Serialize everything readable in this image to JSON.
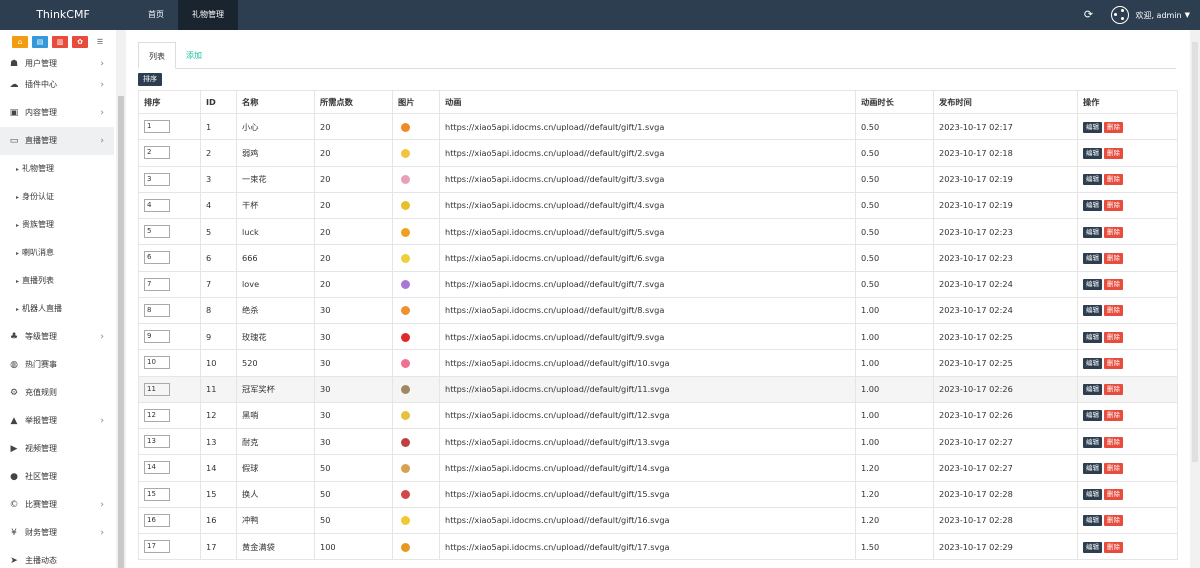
{
  "brand": "ThinkCMF",
  "topnav": [
    {
      "label": "首页",
      "active": false
    },
    {
      "label": "礼物管理",
      "active": true
    }
  ],
  "user": {
    "welcome": "欢迎, admin"
  },
  "sidebar": {
    "quick_colors": [
      "#f39c12",
      "#3498db",
      "#e74c3c",
      "#e74c3c"
    ],
    "items": [
      {
        "label": "用户管理",
        "icon": "users-icon",
        "arrow": true
      },
      {
        "label": "插件中心",
        "icon": "cloud-icon",
        "arrow": true
      },
      {
        "label": "内容管理",
        "icon": "archive-icon",
        "arrow": true
      },
      {
        "label": "直播管理",
        "icon": "monitor-icon",
        "arrow": true,
        "active": true
      },
      {
        "label": "礼物管理",
        "sub": true
      },
      {
        "label": "身份认证",
        "sub": true
      },
      {
        "label": "贵族管理",
        "sub": true
      },
      {
        "label": "喇叭消息",
        "sub": true
      },
      {
        "label": "直播列表",
        "sub": true
      },
      {
        "label": "机器人直播",
        "sub": true
      },
      {
        "label": "等级管理",
        "icon": "sitemap-icon",
        "arrow": true
      },
      {
        "label": "热门赛事",
        "icon": "fire-icon",
        "arrow": false
      },
      {
        "label": "充值规则",
        "icon": "cogs-icon",
        "arrow": false
      },
      {
        "label": "举报管理",
        "icon": "warning-icon",
        "arrow": true
      },
      {
        "label": "视频管理",
        "icon": "video-icon",
        "arrow": false
      },
      {
        "label": "社区管理",
        "icon": "comment-icon",
        "arrow": false
      },
      {
        "label": "比赛管理",
        "icon": "copyright-icon",
        "arrow": true
      },
      {
        "label": "财务管理",
        "icon": "yen-icon",
        "arrow": true
      },
      {
        "label": "主播动态",
        "icon": "paper-plane-icon",
        "arrow": false
      }
    ]
  },
  "tabs": [
    {
      "label": "列表",
      "active": true
    },
    {
      "label": "添加",
      "active": false
    }
  ],
  "sort_button": "排序",
  "table": {
    "headers": [
      "排序",
      "ID",
      "名称",
      "所需点数",
      "图片",
      "动画",
      "动画时长",
      "发布时间",
      "操作"
    ],
    "edit_label": "编辑",
    "delete_label": "删除",
    "rows": [
      {
        "order": "1",
        "id": "1",
        "name": "小心",
        "points": "20",
        "url": "https://xiao5api.idocms.cn/upload//default/gift/1.svga",
        "duration": "0.50",
        "time": "2023-10-17 02:17",
        "color": "#f08a24"
      },
      {
        "order": "2",
        "id": "2",
        "name": "弱鸡",
        "points": "20",
        "url": "https://xiao5api.idocms.cn/upload//default/gift/2.svga",
        "duration": "0.50",
        "time": "2023-10-17 02:18",
        "color": "#f5c342"
      },
      {
        "order": "3",
        "id": "3",
        "name": "一束花",
        "points": "20",
        "url": "https://xiao5api.idocms.cn/upload//default/gift/3.svga",
        "duration": "0.50",
        "time": "2023-10-17 02:19",
        "color": "#e8a0b8"
      },
      {
        "order": "4",
        "id": "4",
        "name": "干杯",
        "points": "20",
        "url": "https://xiao5api.idocms.cn/upload//default/gift/4.svga",
        "duration": "0.50",
        "time": "2023-10-17 02:19",
        "color": "#e6c02a"
      },
      {
        "order": "5",
        "id": "5",
        "name": "luck",
        "points": "20",
        "url": "https://xiao5api.idocms.cn/upload//default/gift/5.svga",
        "duration": "0.50",
        "time": "2023-10-17 02:23",
        "color": "#f0a020"
      },
      {
        "order": "6",
        "id": "6",
        "name": "666",
        "points": "20",
        "url": "https://xiao5api.idocms.cn/upload//default/gift/6.svga",
        "duration": "0.50",
        "time": "2023-10-17 02:23",
        "color": "#ecd03a"
      },
      {
        "order": "7",
        "id": "7",
        "name": "love",
        "points": "20",
        "url": "https://xiao5api.idocms.cn/upload//default/gift/7.svga",
        "duration": "0.50",
        "time": "2023-10-17 02:24",
        "color": "#a878d8"
      },
      {
        "order": "8",
        "id": "8",
        "name": "绝杀",
        "points": "30",
        "url": "https://xiao5api.idocms.cn/upload//default/gift/8.svga",
        "duration": "1.00",
        "time": "2023-10-17 02:24",
        "color": "#f09030"
      },
      {
        "order": "9",
        "id": "9",
        "name": "玫瑰花",
        "points": "30",
        "url": "https://xiao5api.idocms.cn/upload//default/gift/9.svga",
        "duration": "1.00",
        "time": "2023-10-17 02:25",
        "color": "#e02a2a"
      },
      {
        "order": "10",
        "id": "10",
        "name": "520",
        "points": "30",
        "url": "https://xiao5api.idocms.cn/upload//default/gift/10.svga",
        "duration": "1.00",
        "time": "2023-10-17 02:25",
        "color": "#f07090"
      },
      {
        "order": "11",
        "id": "11",
        "name": "冠军奖杯",
        "points": "30",
        "url": "https://xiao5api.idocms.cn/upload//default/gift/11.svga",
        "duration": "1.00",
        "time": "2023-10-17 02:26",
        "color": "#a08860"
      },
      {
        "order": "12",
        "id": "12",
        "name": "黑哨",
        "points": "30",
        "url": "https://xiao5api.idocms.cn/upload//default/gift/12.svga",
        "duration": "1.00",
        "time": "2023-10-17 02:26",
        "color": "#e8c040"
      },
      {
        "order": "13",
        "id": "13",
        "name": "耐克",
        "points": "30",
        "url": "https://xiao5api.idocms.cn/upload//default/gift/13.svga",
        "duration": "1.00",
        "time": "2023-10-17 02:27",
        "color": "#c04040"
      },
      {
        "order": "14",
        "id": "14",
        "name": "假球",
        "points": "50",
        "url": "https://xiao5api.idocms.cn/upload//default/gift/14.svga",
        "duration": "1.20",
        "time": "2023-10-17 02:27",
        "color": "#d8a050"
      },
      {
        "order": "15",
        "id": "15",
        "name": "换人",
        "points": "50",
        "url": "https://xiao5api.idocms.cn/upload//default/gift/15.svga",
        "duration": "1.20",
        "time": "2023-10-17 02:28",
        "color": "#d04848"
      },
      {
        "order": "16",
        "id": "16",
        "name": "冲鸭",
        "points": "50",
        "url": "https://xiao5api.idocms.cn/upload//default/gift/16.svga",
        "duration": "1.20",
        "time": "2023-10-17 02:28",
        "color": "#f0c830"
      },
      {
        "order": "17",
        "id": "17",
        "name": "黄金满袋",
        "points": "100",
        "url": "https://xiao5api.idocms.cn/upload//default/gift/17.svga",
        "duration": "1.50",
        "time": "2023-10-17 02:29",
        "color": "#e89820"
      }
    ]
  }
}
